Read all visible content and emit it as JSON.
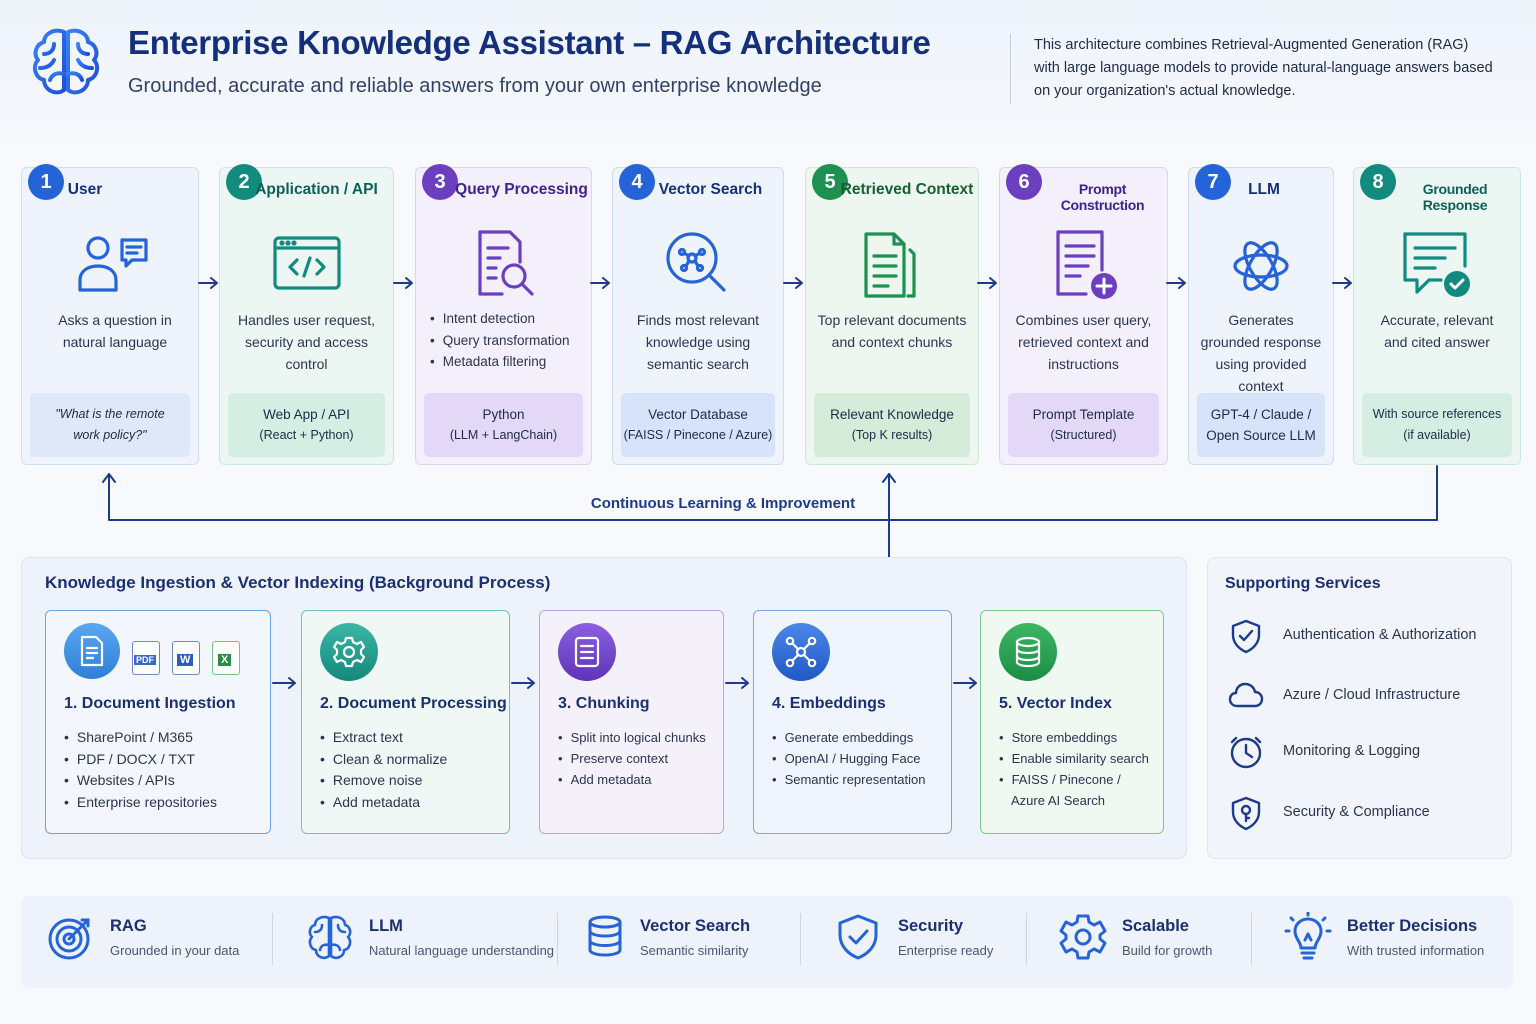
{
  "header": {
    "title": "Enterprise Knowledge Assistant – RAG Architecture",
    "subtitle": "Grounded, accurate and reliable answers from your own enterprise knowledge",
    "intro": "This architecture combines Retrieval-Augmented Generation (RAG) with large language models to provide natural-language answers based on your organization's actual knowledge.",
    "logo_icon": "brain-icon"
  },
  "pipeline": [
    {
      "num": "1",
      "title": "User",
      "icon": "user-chat-icon",
      "desc": "Asks a question in natural language",
      "foot": [
        "\"What is the remote work policy?\""
      ],
      "color": "#2563d8"
    },
    {
      "num": "2",
      "title": "Application / API",
      "icon": "code-window-icon",
      "desc": "Handles user request, security and access control",
      "foot": [
        "Web App / API",
        "(React + Python)"
      ],
      "color": "#138a7e"
    },
    {
      "num": "3",
      "title": "Query Processing",
      "icon": "document-search-icon",
      "bullets": [
        "Intent detection",
        "Query transformation",
        "Metadata filtering"
      ],
      "foot": [
        "Python",
        "(LLM + LangChain)"
      ],
      "color": "#6b3fc0"
    },
    {
      "num": "4",
      "title": "Vector Search",
      "icon": "vector-search-icon",
      "desc": "Finds most relevant knowledge using semantic search",
      "foot": [
        "Vector Database",
        "(FAISS / Pinecone / Azure)"
      ],
      "color": "#2563d8"
    },
    {
      "num": "5",
      "title": "Retrieved Context",
      "icon": "documents-icon",
      "desc": "Top relevant documents and context chunks",
      "foot": [
        "Relevant Knowledge",
        "(Top K results)"
      ],
      "color": "#1e9150"
    },
    {
      "num": "6",
      "title": "Prompt Construction",
      "icon": "document-add-icon",
      "desc": "Combines user query, retrieved context and instructions",
      "foot": [
        "Prompt Template",
        "(Structured)"
      ],
      "color": "#6b3fc0"
    },
    {
      "num": "7",
      "title": "LLM",
      "icon": "llm-knot-icon",
      "desc": "Generates grounded response using provided context",
      "foot": [
        "GPT-4 / Claude /",
        "Open Source LLM"
      ],
      "color": "#2563d8"
    },
    {
      "num": "8",
      "title": "Grounded Response",
      "icon": "chat-check-icon",
      "desc": "Accurate, relevant and cited answer",
      "foot": [
        "With source references",
        "(if available)"
      ],
      "color": "#138a7e"
    }
  ],
  "feedback_label": "Continuous Learning & Improvement",
  "ingestion": {
    "title": "Knowledge Ingestion & Vector Indexing (Background Process)",
    "file_badges": [
      "PDF",
      "W",
      "X"
    ],
    "cards": [
      {
        "title": "1. Document Ingestion",
        "icon": "document-icon",
        "bullets": [
          "SharePoint / M365",
          "PDF / DOCX / TXT",
          "Websites / APIs",
          "Enterprise repositories"
        ]
      },
      {
        "title": "2. Document Processing",
        "icon": "gear-icon",
        "bullets": [
          "Extract text",
          "Clean & normalize",
          "Remove noise",
          "Add metadata"
        ]
      },
      {
        "title": "3. Chunking",
        "icon": "list-document-icon",
        "bullets": [
          "Split into logical chunks",
          "Preserve context",
          "Add metadata"
        ]
      },
      {
        "title": "4. Embeddings",
        "icon": "network-icon",
        "bullets": [
          "Generate embeddings",
          "OpenAI / Hugging Face",
          "Semantic representation"
        ]
      },
      {
        "title": "5. Vector Index",
        "icon": "database-icon",
        "bullets": [
          "Store embeddings",
          "Enable similarity search",
          "FAISS / Pinecone /",
          "Azure AI Search"
        ]
      }
    ]
  },
  "supporting": {
    "title": "Supporting Services",
    "items": [
      {
        "label": "Authentication & Authorization",
        "icon": "shield-check-icon"
      },
      {
        "label": "Azure / Cloud Infrastructure",
        "icon": "cloud-icon"
      },
      {
        "label": "Monitoring & Logging",
        "icon": "clock-icon"
      },
      {
        "label": "Security & Compliance",
        "icon": "shield-key-icon"
      }
    ]
  },
  "benefits": [
    {
      "title": "RAG",
      "sub": "Grounded in your data",
      "icon": "target-icon"
    },
    {
      "title": "LLM",
      "sub": "Natural language understanding",
      "icon": "brain-icon"
    },
    {
      "title": "Vector Search",
      "sub": "Semantic similarity",
      "icon": "database-icon"
    },
    {
      "title": "Security",
      "sub": "Enterprise ready",
      "icon": "shield-check-icon"
    },
    {
      "title": "Scalable",
      "sub": "Build for growth",
      "icon": "gear-icon"
    },
    {
      "title": "Better Decisions",
      "sub": "With trusted information",
      "icon": "lightbulb-icon"
    }
  ]
}
